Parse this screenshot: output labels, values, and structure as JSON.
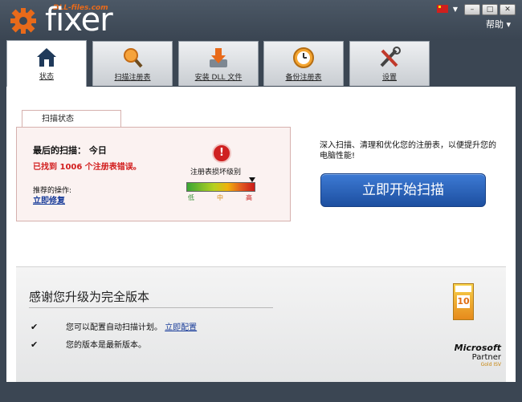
{
  "window": {
    "brand": "fixer",
    "brand_sub": "DLL-files.com",
    "help": "帮助 ▾",
    "controls": {
      "minimize": "–",
      "maximize": "□",
      "close": "✕"
    }
  },
  "tabs": [
    {
      "label": "状态",
      "icon": "home-icon"
    },
    {
      "label": "扫描注册表",
      "icon": "magnifier-icon"
    },
    {
      "label": "安装 DLL 文件",
      "icon": "download-icon"
    },
    {
      "label": "备份注册表",
      "icon": "clock-icon"
    },
    {
      "label": "设置",
      "icon": "tools-icon"
    }
  ],
  "status": {
    "tab_label": "扫描状态",
    "last_scan": "最后的扫描： 今日",
    "found": "已找到 1006 个注册表错误。",
    "severity_label": "注册表损坏级别",
    "meter_labels": [
      "低",
      "中",
      "高"
    ],
    "severity_level": 0.95,
    "recommend": "推荐的操作:",
    "fix_now": "立即修复"
  },
  "scan": {
    "description": "深入扫描、清理和优化您的注册表，以便提升您的电脑性能!",
    "button": "立即开始扫描"
  },
  "upgrade": {
    "title": "感谢您升级为完全版本",
    "row1_text": "您可以配置自动扫描计划。",
    "row1_link": "立即配置",
    "row2_text": "您的版本是最新版本。",
    "check": "✔",
    "award_top": "GOLD",
    "award_mid": "10"
  },
  "microsoft": {
    "brand": "Microsoft",
    "partner": "Partner",
    "tier": "Gold ISV"
  },
  "colors": {
    "accent_blue": "#1d4fa0",
    "error_red": "#d21e1e",
    "link_blue": "#1a3d9a",
    "chrome": "#3b4653",
    "brand_orange": "#e86a1a"
  }
}
